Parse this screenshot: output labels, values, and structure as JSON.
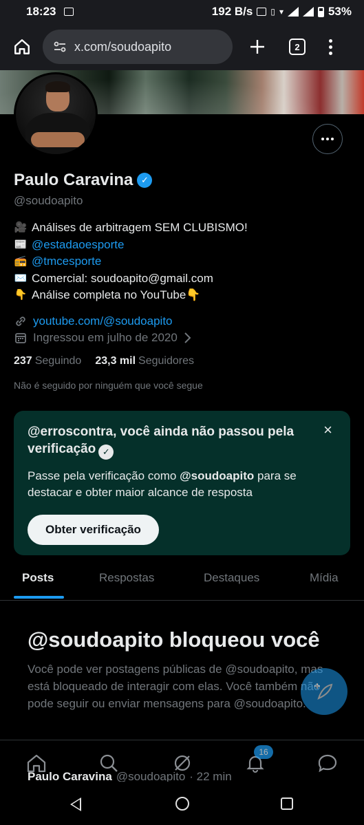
{
  "status_bar": {
    "time": "18:23",
    "speed": "192 B/s",
    "battery": "53%"
  },
  "browser": {
    "url": "x.com/soudoapito",
    "tab_count": "2"
  },
  "profile": {
    "name": "Paulo Caravina",
    "handle": "@soudoapito",
    "bio": [
      {
        "emoji": "🎥",
        "text": "Análises de arbitragem SEM CLUBISMO!",
        "is_link": false
      },
      {
        "emoji": "📰",
        "text": "@estadaoesporte",
        "is_link": true
      },
      {
        "emoji": "📻",
        "text": "@tmcesporte",
        "is_link": true
      },
      {
        "emoji": "✉️",
        "text": "Comercial: soudoapito@gmail.com",
        "is_link": false
      },
      {
        "emoji": "👇",
        "text": "Análise completa no YouTube👇",
        "is_link": false
      }
    ],
    "website": "youtube.com/@soudoapito",
    "joined": "Ingressou em julho de 2020",
    "following_count": "237",
    "following_label": "Seguindo",
    "followers_count": "23,3 mil",
    "followers_label": "Seguidores",
    "not_followed_text": "Não é seguido por ninguém que você segue"
  },
  "verify_card": {
    "title": "@erroscontra, você ainda não passou pela verificação",
    "desc_prefix": "Passe pela verificação como ",
    "desc_handle": "@soudoapito",
    "desc_suffix": " para se destacar e obter maior alcance de resposta",
    "button": "Obter verificação",
    "close": "×"
  },
  "tabs": [
    "Posts",
    "Respostas",
    "Destaques",
    "Mídia"
  ],
  "blocked": {
    "title": "@soudoapito bloqueou você",
    "description": "Você pode ver postagens públicas de @soudoapito, mas está bloqueado de interagir com elas. Você também não pode seguir ou enviar mensagens para @soudoapito."
  },
  "bottom_nav": {
    "notifications_badge": "16"
  },
  "peek_post": {
    "name": "Paulo Caravina",
    "handle": "@soudoapito",
    "time": "· 22 min"
  },
  "colors": {
    "accent": "#1d9bf0",
    "card_bg": "#05302a",
    "muted": "#71767b"
  }
}
